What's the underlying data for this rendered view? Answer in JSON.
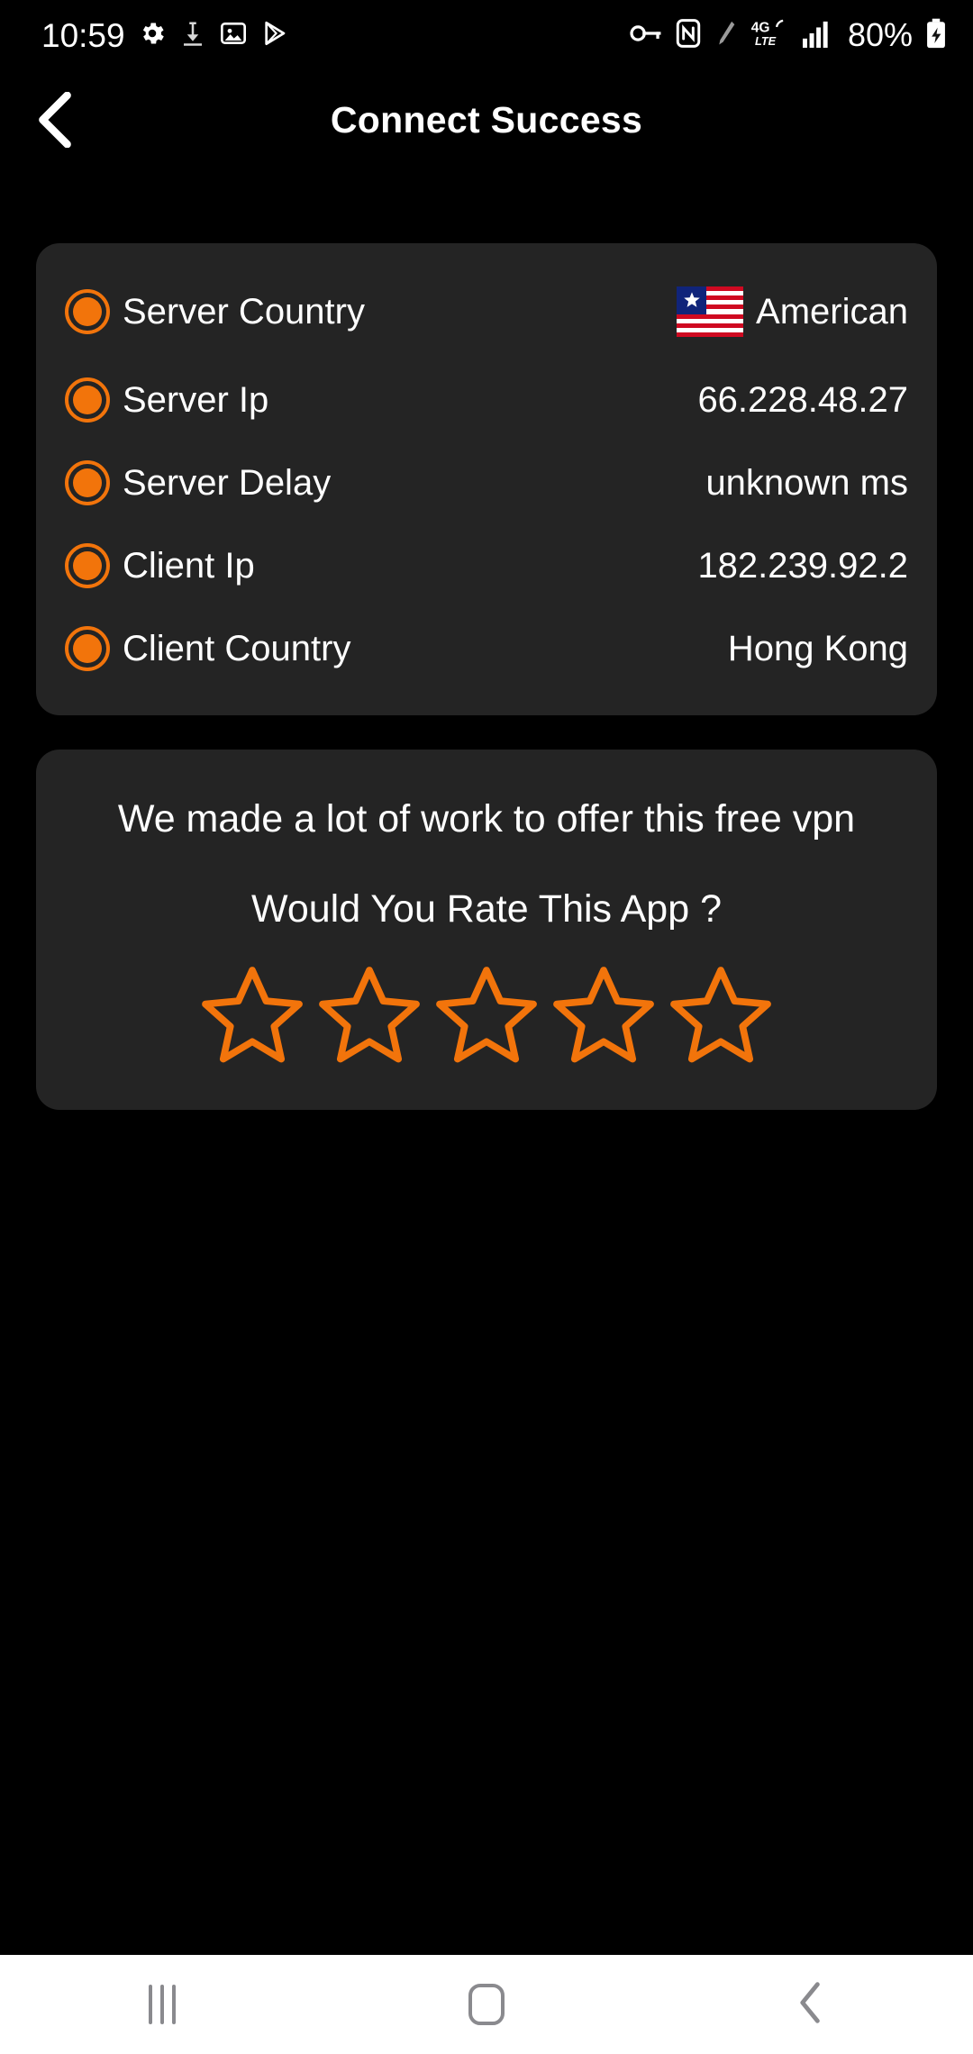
{
  "status_bar": {
    "clock": "10:59",
    "battery_percent": "80%",
    "network": "4G LTE",
    "left_icons": [
      "settings-gear-icon",
      "download-icon",
      "image-icon",
      "play-store-icon"
    ],
    "right_icons": [
      "vpn-key-icon",
      "nfc-icon",
      "pencil-icon",
      "network-4glte-icon",
      "signal-bars-icon",
      "battery-charging-icon"
    ]
  },
  "app_bar": {
    "back_label": "back-chevron-icon",
    "title": "Connect Success"
  },
  "info_card": {
    "rows": [
      {
        "label": "Server Country",
        "value": "American",
        "flag": "liberia-flag"
      },
      {
        "label": "Server Ip",
        "value": "66.228.48.27"
      },
      {
        "label": "Server Delay",
        "value": "unknown ms"
      },
      {
        "label": "Client Ip",
        "value": "182.239.92.2"
      },
      {
        "label": "Client Country",
        "value": "Hong Kong"
      }
    ]
  },
  "rate_card": {
    "headline": "We made a lot of work to offer this free vpn",
    "question": "Would You Rate This App ?",
    "star_count": 5,
    "stars_filled": 0
  },
  "nav_bar": {
    "recents_label": "recents-button",
    "home_label": "home-button",
    "back_label": "back-button"
  },
  "colors": {
    "accent": "#F2740B",
    "background": "#000000",
    "card": "#242424",
    "text": "#FFFFFF",
    "nav_icon": "#8A8A8E"
  }
}
